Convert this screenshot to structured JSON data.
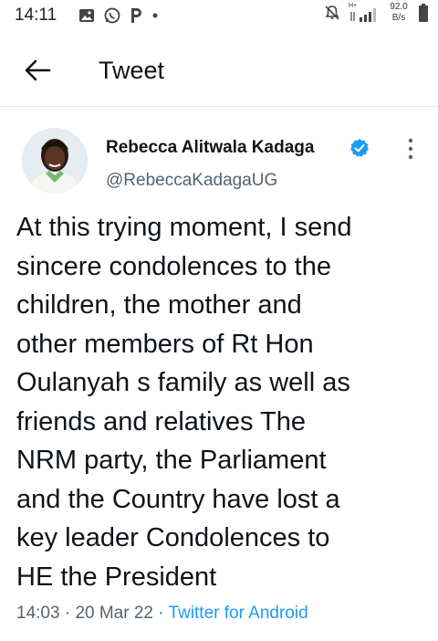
{
  "status_bar": {
    "time": "14:11",
    "network_speed_value": "92.0",
    "network_speed_unit": "B/s",
    "network_type": "H+",
    "left_icons": [
      "gallery-icon",
      "whatsapp-icon",
      "p-app-icon",
      "dot-icon"
    ],
    "right_icons": [
      "mute-icon",
      "signal-icon",
      "battery-icon"
    ]
  },
  "header": {
    "title": "Tweet"
  },
  "tweet": {
    "author_name": "Rebecca Alitwala Kadaga",
    "author_handle": "@RebeccaKadagaUG",
    "text": "At  this  trying moment, I send\nsincere condolences  to the\nchildren,  the mother and\nother members of  Rt Hon\nOulanyah s family as well as\nfriends and relatives    The\nNRM  party, the Parliament\nand the Country  have  lost a\nkey leader   Condolences  to\nHE the President",
    "time": "14:03",
    "date": "20 Mar 22",
    "separator": "·",
    "source": "Twitter for Android",
    "verified_color": "#1d9bf0"
  }
}
